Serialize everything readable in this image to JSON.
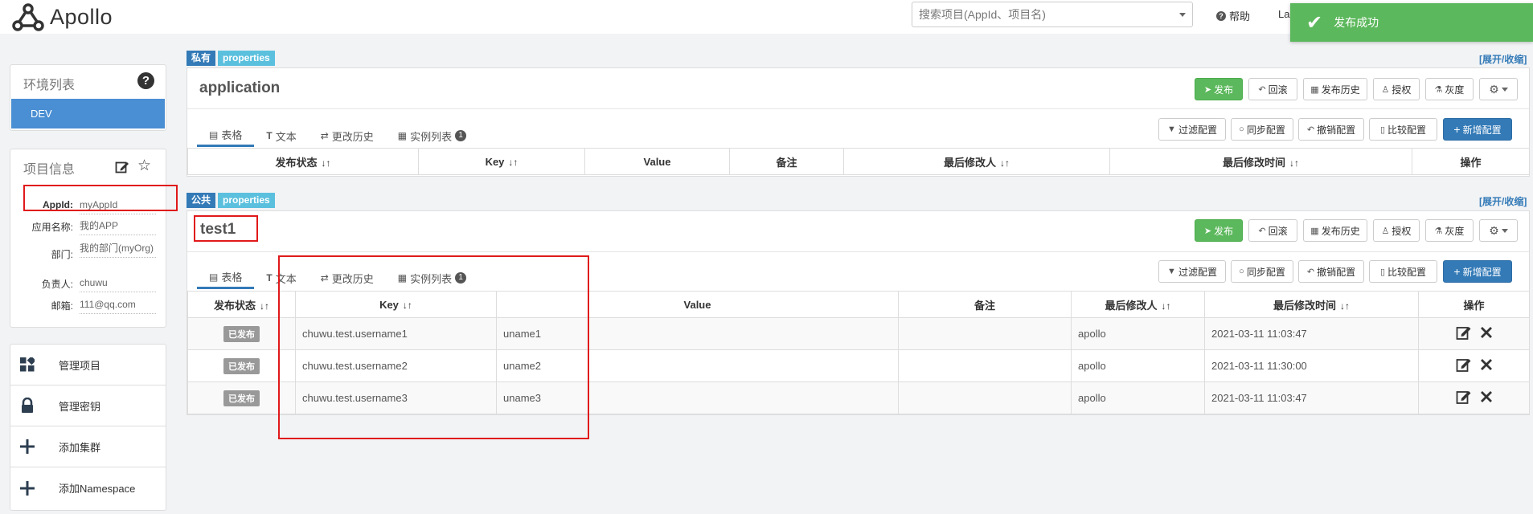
{
  "app": {
    "name": "Apollo"
  },
  "header": {
    "search_placeholder": "搜索项目(AppId、项目名)",
    "help_label": "帮助",
    "lang_label": "La"
  },
  "toast": {
    "message": "发布成功",
    "color": "#5cb85c"
  },
  "sidebar": {
    "env_title": "环境列表",
    "env_items": [
      {
        "label": "DEV",
        "selected": true
      }
    ],
    "project_title": "项目信息",
    "project_info": [
      {
        "label": "AppId:",
        "value": "myAppId"
      },
      {
        "label": "应用名称:",
        "value": "我的APP"
      },
      {
        "label": "部门:",
        "value": "我的部门(myOrg)"
      },
      {
        "label": "负责人:",
        "value": "chuwu"
      },
      {
        "label": "邮箱:",
        "value": "111@qq.com"
      }
    ],
    "nav": [
      {
        "label": "管理项目",
        "icon": "dashboard-icon"
      },
      {
        "label": "管理密钥",
        "icon": "lock-icon"
      },
      {
        "label": "添加集群",
        "icon": "plus-icon"
      },
      {
        "label": "添加Namespace",
        "icon": "plus-icon"
      }
    ]
  },
  "toolbar": {
    "publish": "发布",
    "rollback": "回滚",
    "publish_history": "发布历史",
    "grant": "授权",
    "gray": "灰度",
    "filter_config": "过滤配置",
    "sync_config": "同步配置",
    "revoke_config": "撤销配置",
    "compare_config": "比较配置",
    "add_config": "新增配置"
  },
  "tabs": [
    "表格",
    "文本",
    "更改历史",
    "实例列表"
  ],
  "instance_count": "1",
  "expand_label": "[展开/收缩]",
  "namespaces": [
    {
      "scope": "私有",
      "format": "properties",
      "name": "application",
      "columns": [
        "发布状态",
        "Key",
        "Value",
        "备注",
        "最后修改人",
        "最后修改时间",
        "操作"
      ],
      "rows": []
    },
    {
      "scope": "公共",
      "format": "properties",
      "name": "test1",
      "columns": [
        "发布状态",
        "Key",
        "Value",
        "备注",
        "最后修改人",
        "最后修改时间",
        "操作"
      ],
      "rows": [
        {
          "status": "已发布",
          "key": "chuwu.test.username1",
          "value": "uname1",
          "comment": "",
          "modifier": "apollo",
          "time": "2021-03-11 11:03:47"
        },
        {
          "status": "已发布",
          "key": "chuwu.test.username2",
          "value": "uname2",
          "comment": "",
          "modifier": "apollo",
          "time": "2021-03-11 11:30:00"
        },
        {
          "status": "已发布",
          "key": "chuwu.test.username3",
          "value": "uname3",
          "comment": "",
          "modifier": "apollo",
          "time": "2021-03-11 11:03:47"
        }
      ]
    }
  ]
}
